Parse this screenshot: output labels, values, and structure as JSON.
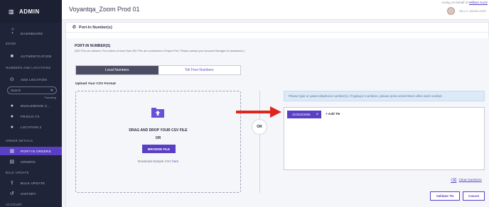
{
  "sidebar": {
    "brand": "ADMIN",
    "items": [
      {
        "label": "DASHBOARD",
        "icon": "dashboard-icon"
      },
      {
        "label": "AUTHENTICATION",
        "icon": "camera-icon"
      },
      {
        "label": "ADD LOCATION",
        "icon": "location-pin-icon"
      },
      {
        "label": "ENGLEWOOD C...",
        "icon": "location-pin-icon"
      },
      {
        "label": "FRISCO,TX",
        "icon": "location-pin-icon"
      },
      {
        "label": "LOCATION 2",
        "icon": "location-pin-icon"
      },
      {
        "label": "PORT-IN ORDERS",
        "icon": "grid-icon"
      },
      {
        "label": "ORDERS",
        "icon": "list-icon"
      },
      {
        "label": "BULK UPDATE",
        "icon": "upload-icon"
      },
      {
        "label": "HISTORY",
        "icon": "history-icon"
      }
    ],
    "sections": {
      "zoom": "ZOOM",
      "numbers": "NUMBERS AND LOCATIONS",
      "order": "ORDER DETAILS",
      "bulk": "BULK UPDATE",
      "account": "ACCOUNT"
    },
    "search_placeholder": "Search",
    "search_hint": "Ftwostring"
  },
  "header": {
    "title": "Voyantqa_Zoom Prod 01",
    "acting_prefix": "Acting on behalf of",
    "acting_user": "William Kurtz",
    "hello": "HELLO, ADMIN USER"
  },
  "page": {
    "title": "Port-In Number(s)",
    "section_title": "PORT-IN NUMBER(S)",
    "section_subtitle": "(250 TN's are allowed, Port orders of more than 250 TN's are considered a Project Port. Please contact your Account Manager for assistance.)",
    "tabs": [
      "Local Numbers",
      "Toll Free Numbers"
    ],
    "upload_label": "Upload Your CSV Format",
    "drop_title": "DRAG AND DROP YOUR CSV FILE",
    "drop_or": "OR",
    "browse_label": "BROWSE FILE",
    "sample_prefix": "Download Sample CSV",
    "sample_link": "here",
    "or_label": "OR",
    "hint": "Please type or paste telephone number(s). If typing in numbers, please press enter/return after each number.",
    "chip_value": "2102223456",
    "add_tn": "+ Add TN",
    "clear_label": "Clear Numbers",
    "validate_label": "Validate TN",
    "cancel_label": "Cancel"
  },
  "colors": {
    "accent": "#5a3fc4",
    "sidebar_bg": "#1f2438",
    "arrow": "#e0261c"
  }
}
